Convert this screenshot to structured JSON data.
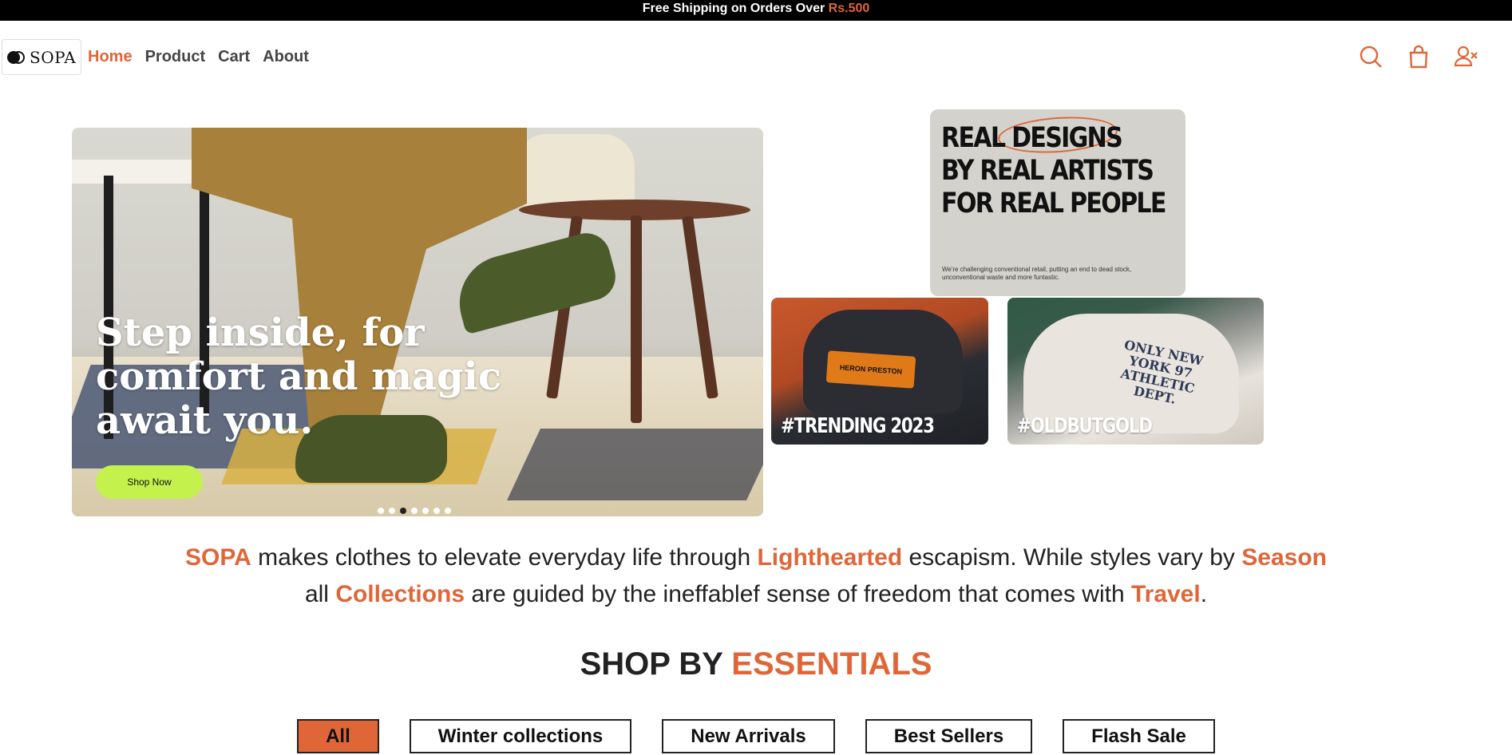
{
  "announcement": {
    "text": "Free Shipping on Orders Over ",
    "amount": "Rs.500"
  },
  "brand": {
    "name": "SOPA"
  },
  "nav": {
    "items": [
      {
        "label": "Home",
        "active": true
      },
      {
        "label": "Product",
        "active": false
      },
      {
        "label": "Cart",
        "active": false
      },
      {
        "label": "About",
        "active": false
      }
    ],
    "icons": [
      "search-icon",
      "shopping-bag-icon",
      "user-remove-icon"
    ]
  },
  "hero": {
    "title": "Step inside, for comfort and magic await you.",
    "cta": "Shop Now",
    "slides_count": 7,
    "active_slide": 3
  },
  "promo": {
    "headline_line1_a": "REAL ",
    "headline_line1_b": "DESIGNS",
    "headline_line2": "BY REAL ARTISTS",
    "headline_line3": "FOR REAL PEOPLE",
    "body": "We're challenging conventional retail, putting an end to dead stock, unconventional waste and more funtastic."
  },
  "tiles": [
    {
      "tag": "#TRENDING 2023",
      "patch": "HERON PRESTON"
    },
    {
      "tag": "#OLDBUTGOLD",
      "embroidery": "ONLY NEW YORK 97 ATHLETIC DEPT."
    }
  ],
  "about": {
    "brand": "SOPA",
    "t1": " makes clothes to elevate everyday life through ",
    "h1": "Lighthearted",
    "t2": " escapism. While styles vary by ",
    "h2": "Season",
    "t3": " all ",
    "h3": "Collections",
    "t4": " are guided by the ineffablef sense of freedom that comes with ",
    "h4": "Travel",
    "t5": "."
  },
  "section": {
    "title_a": "SHOP BY ",
    "title_b": "ESSENTIALS"
  },
  "filters": [
    {
      "label": "All",
      "active": true
    },
    {
      "label": "Winter collections",
      "active": false
    },
    {
      "label": "New Arrivals",
      "active": false
    },
    {
      "label": "Best Sellers",
      "active": false
    },
    {
      "label": "Flash Sale",
      "active": false
    }
  ],
  "colors": {
    "accent": "#e06638",
    "cta": "#c4f14c",
    "topbar": "#000000"
  }
}
